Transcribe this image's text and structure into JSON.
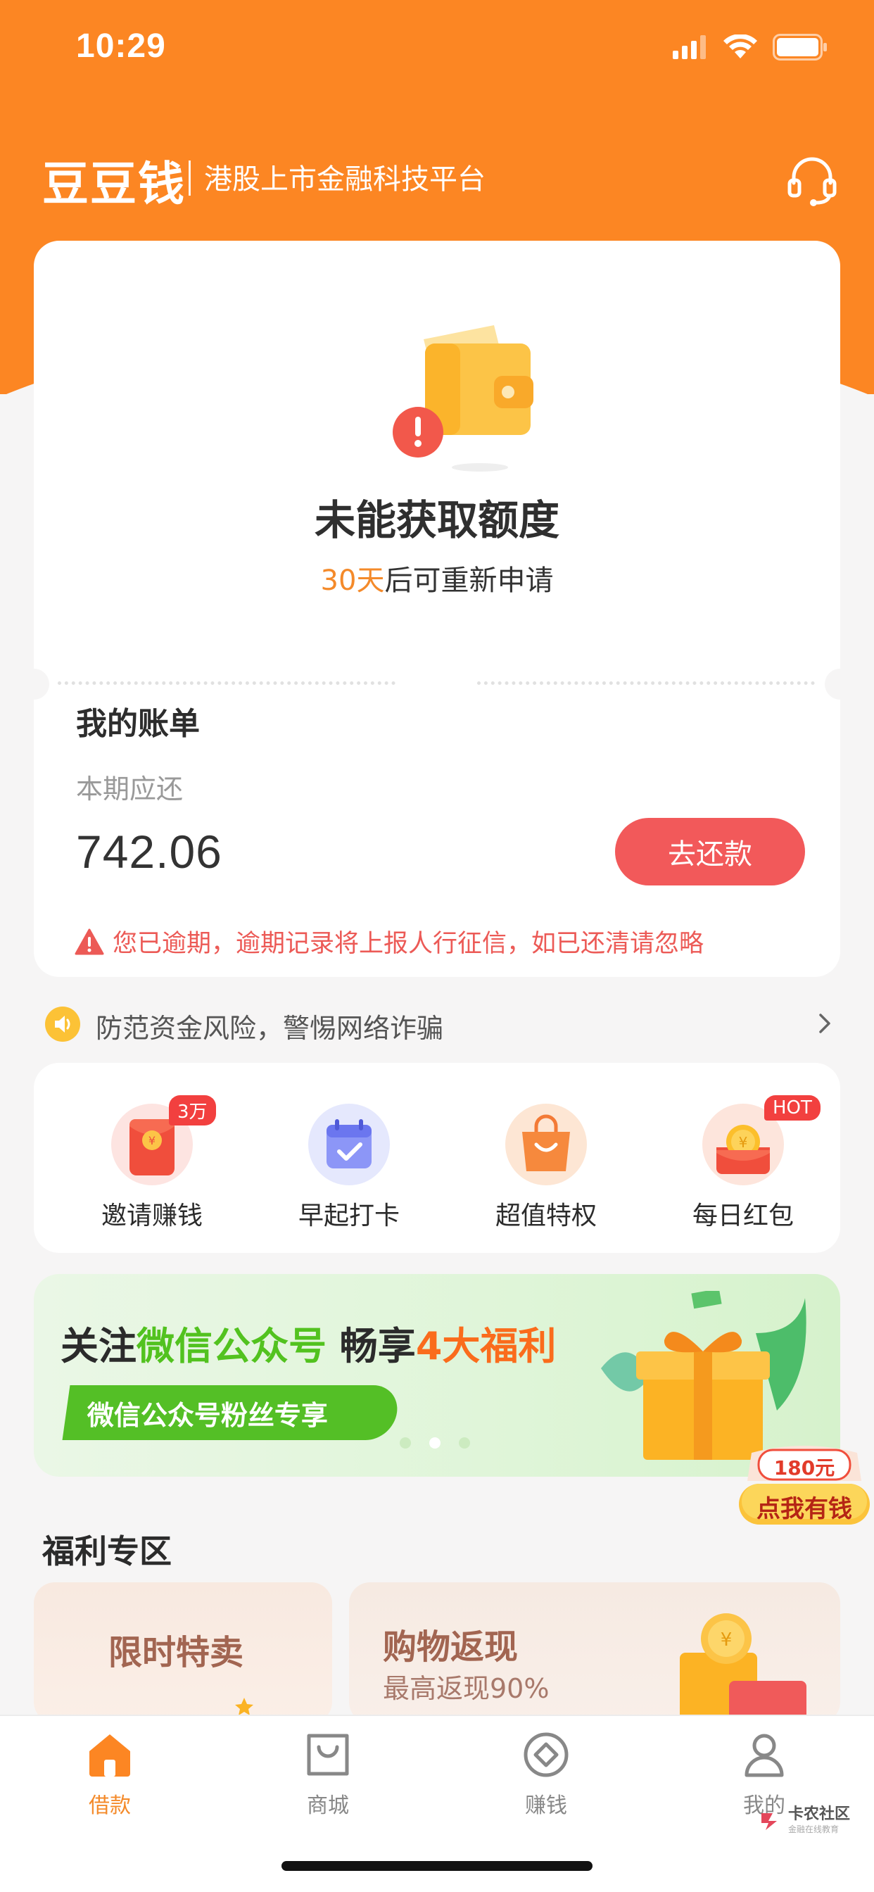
{
  "status_bar": {
    "time": "10:29"
  },
  "header": {
    "brand": "豆豆钱",
    "slogan": "港股上市金融科技平台",
    "service_icon": "headset-icon"
  },
  "quota": {
    "title": "未能获取额度",
    "days": "30天",
    "sub_suffix": "后可重新申请"
  },
  "bill": {
    "title": "我的账单",
    "label": "本期应还",
    "amount": "742.06",
    "repay_label": "去还款",
    "overdue_text": "您已逾期，逾期记录将上报人行征信，如已还清请忽略"
  },
  "notice": {
    "text": "防范资金风险，警惕网络诈骗"
  },
  "features": [
    {
      "label": "邀请赚钱",
      "badge": "3万",
      "icon": "red-envelope-icon"
    },
    {
      "label": "早起打卡",
      "badge": "",
      "icon": "calendar-check-icon"
    },
    {
      "label": "超值特权",
      "badge": "",
      "icon": "shopping-bag-icon"
    },
    {
      "label": "每日红包",
      "badge": "HOT",
      "icon": "coin-envelope-icon"
    }
  ],
  "banner": {
    "title_prefix": "关注",
    "title_green": "微信公众号",
    "title_mid": " 畅享",
    "title_orange": "4大福利",
    "pill": "微信公众号粉丝专享",
    "page_count": 3,
    "active_page": 2
  },
  "floating_coupon": {
    "amount": "180元",
    "label": "点我有钱"
  },
  "welfare": {
    "title": "福利专区",
    "items": [
      {
        "title": "限时特卖",
        "sub": ""
      },
      {
        "title": "购物返现",
        "sub": "最高返现90%"
      }
    ]
  },
  "tabs": [
    {
      "label": "借款",
      "icon": "home-icon",
      "active": true
    },
    {
      "label": "商城",
      "icon": "bag-icon",
      "active": false
    },
    {
      "label": "赚钱",
      "icon": "diamond-coin-icon",
      "active": false
    },
    {
      "label": "我的",
      "icon": "user-icon",
      "active": false
    }
  ],
  "watermark": {
    "label": "卡农社区",
    "sub": "金融在线教育"
  },
  "colors": {
    "brand_orange": "#fc8623",
    "repay_red": "#f2595a",
    "accent_orange": "#f48a2a",
    "wechat_green": "#54bf26"
  }
}
